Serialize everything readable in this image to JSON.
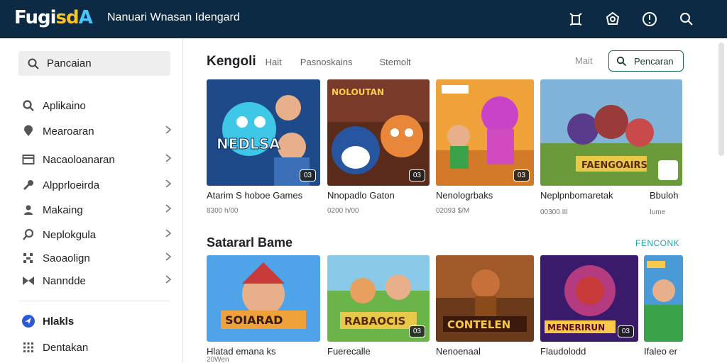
{
  "header": {
    "logo": [
      "Fugi",
      "sd",
      "A"
    ],
    "title": "Nanuari Wnasan Idengard"
  },
  "sidebar": {
    "search_placeholder": "Pancaian",
    "items": [
      {
        "label": "Aplikaino",
        "icon": "search-icon",
        "chevron": false
      },
      {
        "label": "Mearoaran",
        "icon": "location-icon",
        "chevron": true
      },
      {
        "label": "Nacaoloanaran",
        "icon": "window-icon",
        "chevron": true
      },
      {
        "label": "Alpprloeirda",
        "icon": "wrench-icon",
        "chevron": true
      },
      {
        "label": "Makaing",
        "icon": "person-icon",
        "chevron": true
      },
      {
        "label": "Neplokgula",
        "icon": "chat-search-icon",
        "chevron": true
      },
      {
        "label": "Saoaolign",
        "icon": "sparkle-icon",
        "chevron": true
      },
      {
        "label": "Nanndde",
        "icon": "bowtie-icon",
        "chevron": true
      }
    ],
    "bottom_items": [
      {
        "label": "Hlakls",
        "icon": "globe-icon"
      },
      {
        "label": "Dentakan",
        "icon": "grid-icon"
      }
    ]
  },
  "main": {
    "tabs": [
      "Kengoli",
      "Hait",
      "Pasnoskains",
      "Stemolt"
    ],
    "more_link": "Mait",
    "search_button": "Pencaran",
    "section1_cards": [
      {
        "title": "Atarim S hoboe Games",
        "meta": "8300 h/00",
        "badge": "03"
      },
      {
        "title": "Nnopadlo Gaton",
        "meta": "0200 h/00",
        "badge": "03"
      },
      {
        "title": "Nenologrbaks",
        "meta": "02093 $/M",
        "badge": "03"
      },
      {
        "title": "Neplpnbomaretak",
        "meta": "00300 III",
        "badge": ""
      },
      {
        "title": "Bbuloh",
        "meta": "Iume",
        "badge": ""
      }
    ],
    "section2_title": "Satararl Bame",
    "section2_link": "FENCONK",
    "section2_cards": [
      {
        "title": "Hlatad emana ks",
        "meta": "20Wen",
        "badge": ""
      },
      {
        "title": "Fuerecalle",
        "meta": "",
        "badge": "03"
      },
      {
        "title": "Nenoenaal",
        "meta": "",
        "badge": ""
      },
      {
        "title": "Flaudolodd",
        "meta": "",
        "badge": "03"
      },
      {
        "title": "Ifaleo er",
        "meta": "",
        "badge": ""
      }
    ]
  },
  "colors": {
    "topbar": "#0d2a44",
    "accent_green": "#1b6b52",
    "accent_teal": "#2aa3a3"
  }
}
